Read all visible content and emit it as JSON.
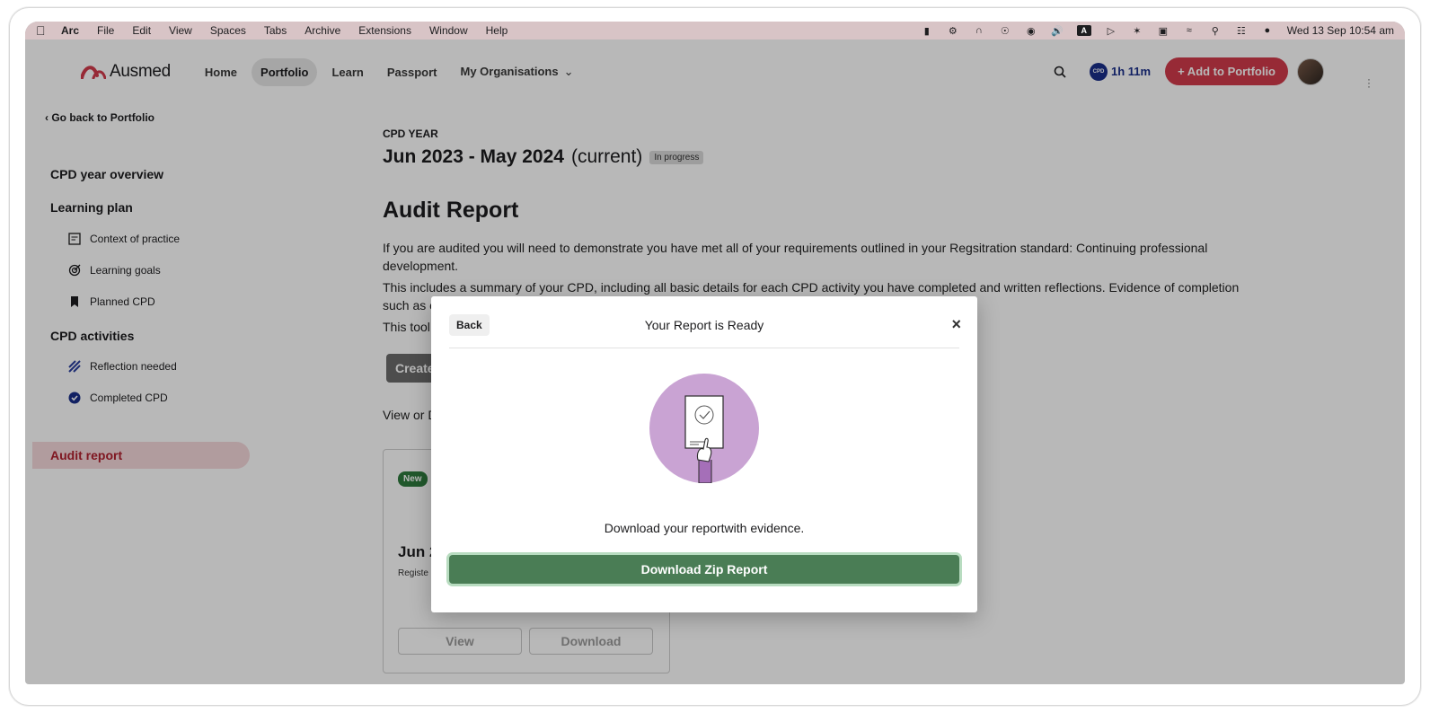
{
  "menubar": {
    "app": "Arc",
    "items": [
      "File",
      "Edit",
      "View",
      "Spaces",
      "Tabs",
      "Archive",
      "Extensions",
      "Window",
      "Help"
    ],
    "clock": "Wed 13 Sep  10:54 am",
    "input_badge": "A"
  },
  "nav": {
    "logo": "Ausmed",
    "links": [
      "Home",
      "Portfolio",
      "Learn",
      "Passport",
      "My Organisations"
    ],
    "active_link": "Portfolio",
    "cpd_seal": "CPD",
    "cpd_time": "1h 11m",
    "add_button": "+ Add to Portfolio"
  },
  "sidebar": {
    "back": "Go back to Portfolio",
    "sections": {
      "overview": "CPD year overview",
      "learning_plan": "Learning plan",
      "cpd_activities": "CPD activities",
      "audit_report": "Audit report"
    },
    "learning_plan_items": [
      "Context of practice",
      "Learning goals",
      "Planned CPD"
    ],
    "activity_items": [
      "Reflection needed",
      "Completed CPD"
    ]
  },
  "main": {
    "eyebrow": "CPD YEAR",
    "year_range": "Jun 2023 - May 2024",
    "current": "(current)",
    "status": "In progress",
    "heading": "Audit Report",
    "para1": "If you are audited you will need to demonstrate you have met all of your requirements outlined in your Regsitration standard: Continuing professional development.",
    "para2": "This includes a summary of your CPD, including all basic details for each CPD activity you have completed and written reflections. Evidence of completion such as c",
    "para3": "This tool",
    "create_button": "Create",
    "view_or": "View or D",
    "card": {
      "badge": "New",
      "title": "Jun 2",
      "subtitle": "Registe",
      "view": "View",
      "download": "Download"
    }
  },
  "modal": {
    "back": "Back",
    "title": "Your Report is Ready",
    "close": "×",
    "message": "Download your reportwith evidence.",
    "download_button": "Download Zip Report"
  }
}
